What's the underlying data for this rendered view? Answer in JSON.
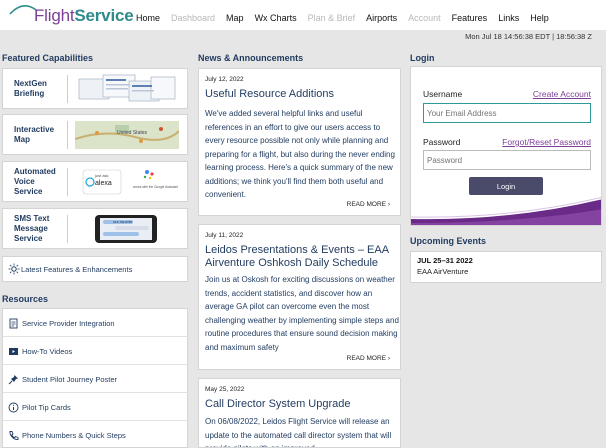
{
  "brand": {
    "name_part1": "Flight",
    "name_part2": "Service"
  },
  "nav": [
    {
      "label": "Home",
      "enabled": true
    },
    {
      "label": "Dashboard",
      "enabled": false
    },
    {
      "label": "Map",
      "enabled": true
    },
    {
      "label": "Wx Charts",
      "enabled": true
    },
    {
      "label": "Plan & Brief",
      "enabled": false
    },
    {
      "label": "Airports",
      "enabled": true
    },
    {
      "label": "Account",
      "enabled": false
    },
    {
      "label": "Features",
      "enabled": true
    },
    {
      "label": "Links",
      "enabled": true
    },
    {
      "label": "Help",
      "enabled": true
    }
  ],
  "clock": "Mon Jul 18 14:56:38 EDT | 18:56:38 Z",
  "featured": {
    "title": "Featured Capabilities",
    "items": [
      {
        "label": "NextGen Briefing"
      },
      {
        "label": "Interactive Map",
        "thumb_text": "United States"
      },
      {
        "label": "Automated Voice Service",
        "alexa": "alexa",
        "alexa_top": "just ask",
        "google": "works with the Google Assistant"
      },
      {
        "label": "SMS Text Message Service",
        "phone_text": "S16-762-8768"
      }
    ],
    "latest": "Latest Features & Enhancements"
  },
  "resources": {
    "title": "Resources",
    "items": [
      "Service Provider Integration",
      "How-To Videos",
      "Student Pilot Journey Poster",
      "Pilot Tip Cards",
      "Phone Numbers & Quick Steps"
    ]
  },
  "news": {
    "title": "News & Announcements",
    "items": [
      {
        "date": "July 12, 2022",
        "title": "Useful Resource Additions",
        "body": "We've added several helpful links and useful references in an effort to give our users access to every resource possible not only while planning and preparing for a flight, but also during the never ending learning process. Here's a quick summary of the new additions; we think you'll find them both useful and convenient.",
        "more": "READ MORE ›"
      },
      {
        "date": "July 11, 2022",
        "title": "Leidos Presentations & Events – EAA Airventure Oshkosh Daily Schedule",
        "body": "Join us at Oskosh for exciting discussions on weather trends, accident statistics, and discover how an average GA pilot can overcome even the most challenging weather by implementing simple steps and routine procedures that ensure sound decision making and maximum safety",
        "more": "READ MORE ›"
      },
      {
        "date": "May 25, 2022",
        "title": "Call Director System Upgrade",
        "body": "On 06/08/2022, Leidos Flight Service will release an update to the automated call director system that will provide pilots with an improved",
        "more": ""
      }
    ]
  },
  "login": {
    "title": "Login",
    "username_label": "Username",
    "create_account": "Create Account",
    "username_placeholder": "Your Email Address",
    "password_label": "Password",
    "forgot": "Forgot/Reset Password",
    "password_placeholder": "Password",
    "button": "Login"
  },
  "events": {
    "title": "Upcoming Events",
    "items": [
      {
        "date": "JUL 25–31 2022",
        "name": "EAA AirVenture"
      }
    ]
  },
  "colors": {
    "accent": "#7b3f98",
    "teal": "#2e8b8b",
    "navy": "#1f3a5f"
  }
}
